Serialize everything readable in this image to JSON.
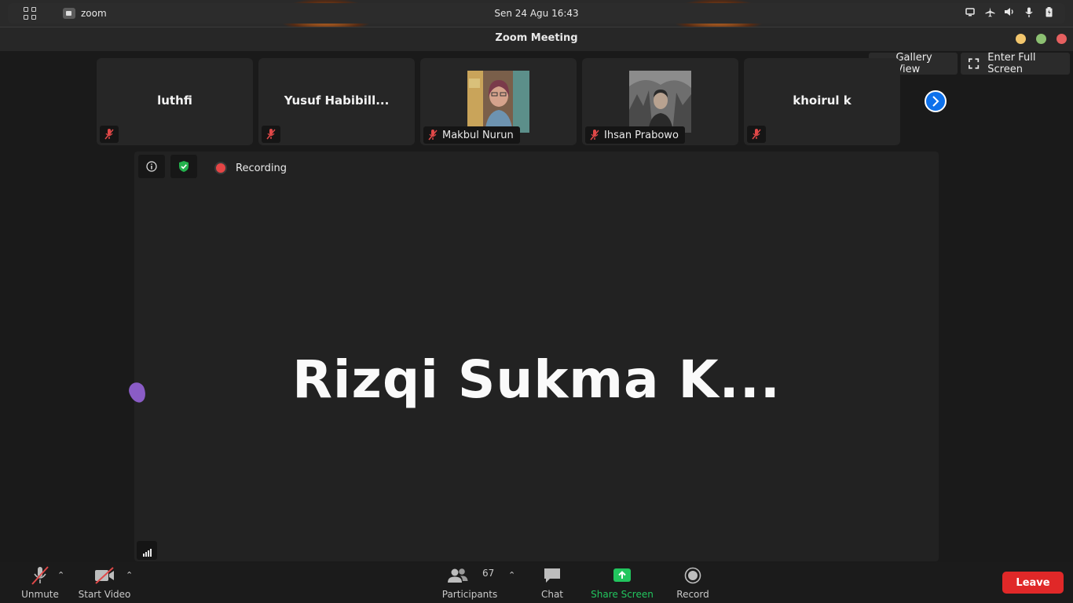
{
  "system_bar": {
    "app_name": "zoom",
    "clock": "Sen 24 Agu  16:43"
  },
  "window": {
    "title": "Zoom Meeting"
  },
  "view_controls": {
    "gallery_view": "Gallery View",
    "full_screen": "Enter Full Screen"
  },
  "participants_strip": [
    {
      "name": "luthfi",
      "has_video": false
    },
    {
      "name": "Yusuf Habibill...",
      "has_video": false
    },
    {
      "name": "Makbul Nurun",
      "has_video": true
    },
    {
      "name": "Ihsan Prabowo",
      "has_video": true
    },
    {
      "name": "khoirul k",
      "has_video": false
    }
  ],
  "stage": {
    "speaker": "Rizqi Sukma K...",
    "recording_label": "Recording"
  },
  "toolbar": {
    "unmute": "Unmute",
    "start_video": "Start Video",
    "participants": "Participants",
    "participants_count": "67",
    "chat": "Chat",
    "share_screen": "Share Screen",
    "record": "Record",
    "leave": "Leave"
  },
  "colors": {
    "share_green": "#22c55e",
    "leave_red": "#e02828",
    "mute_red": "#e04848",
    "accent_blue": "#0e71eb"
  }
}
